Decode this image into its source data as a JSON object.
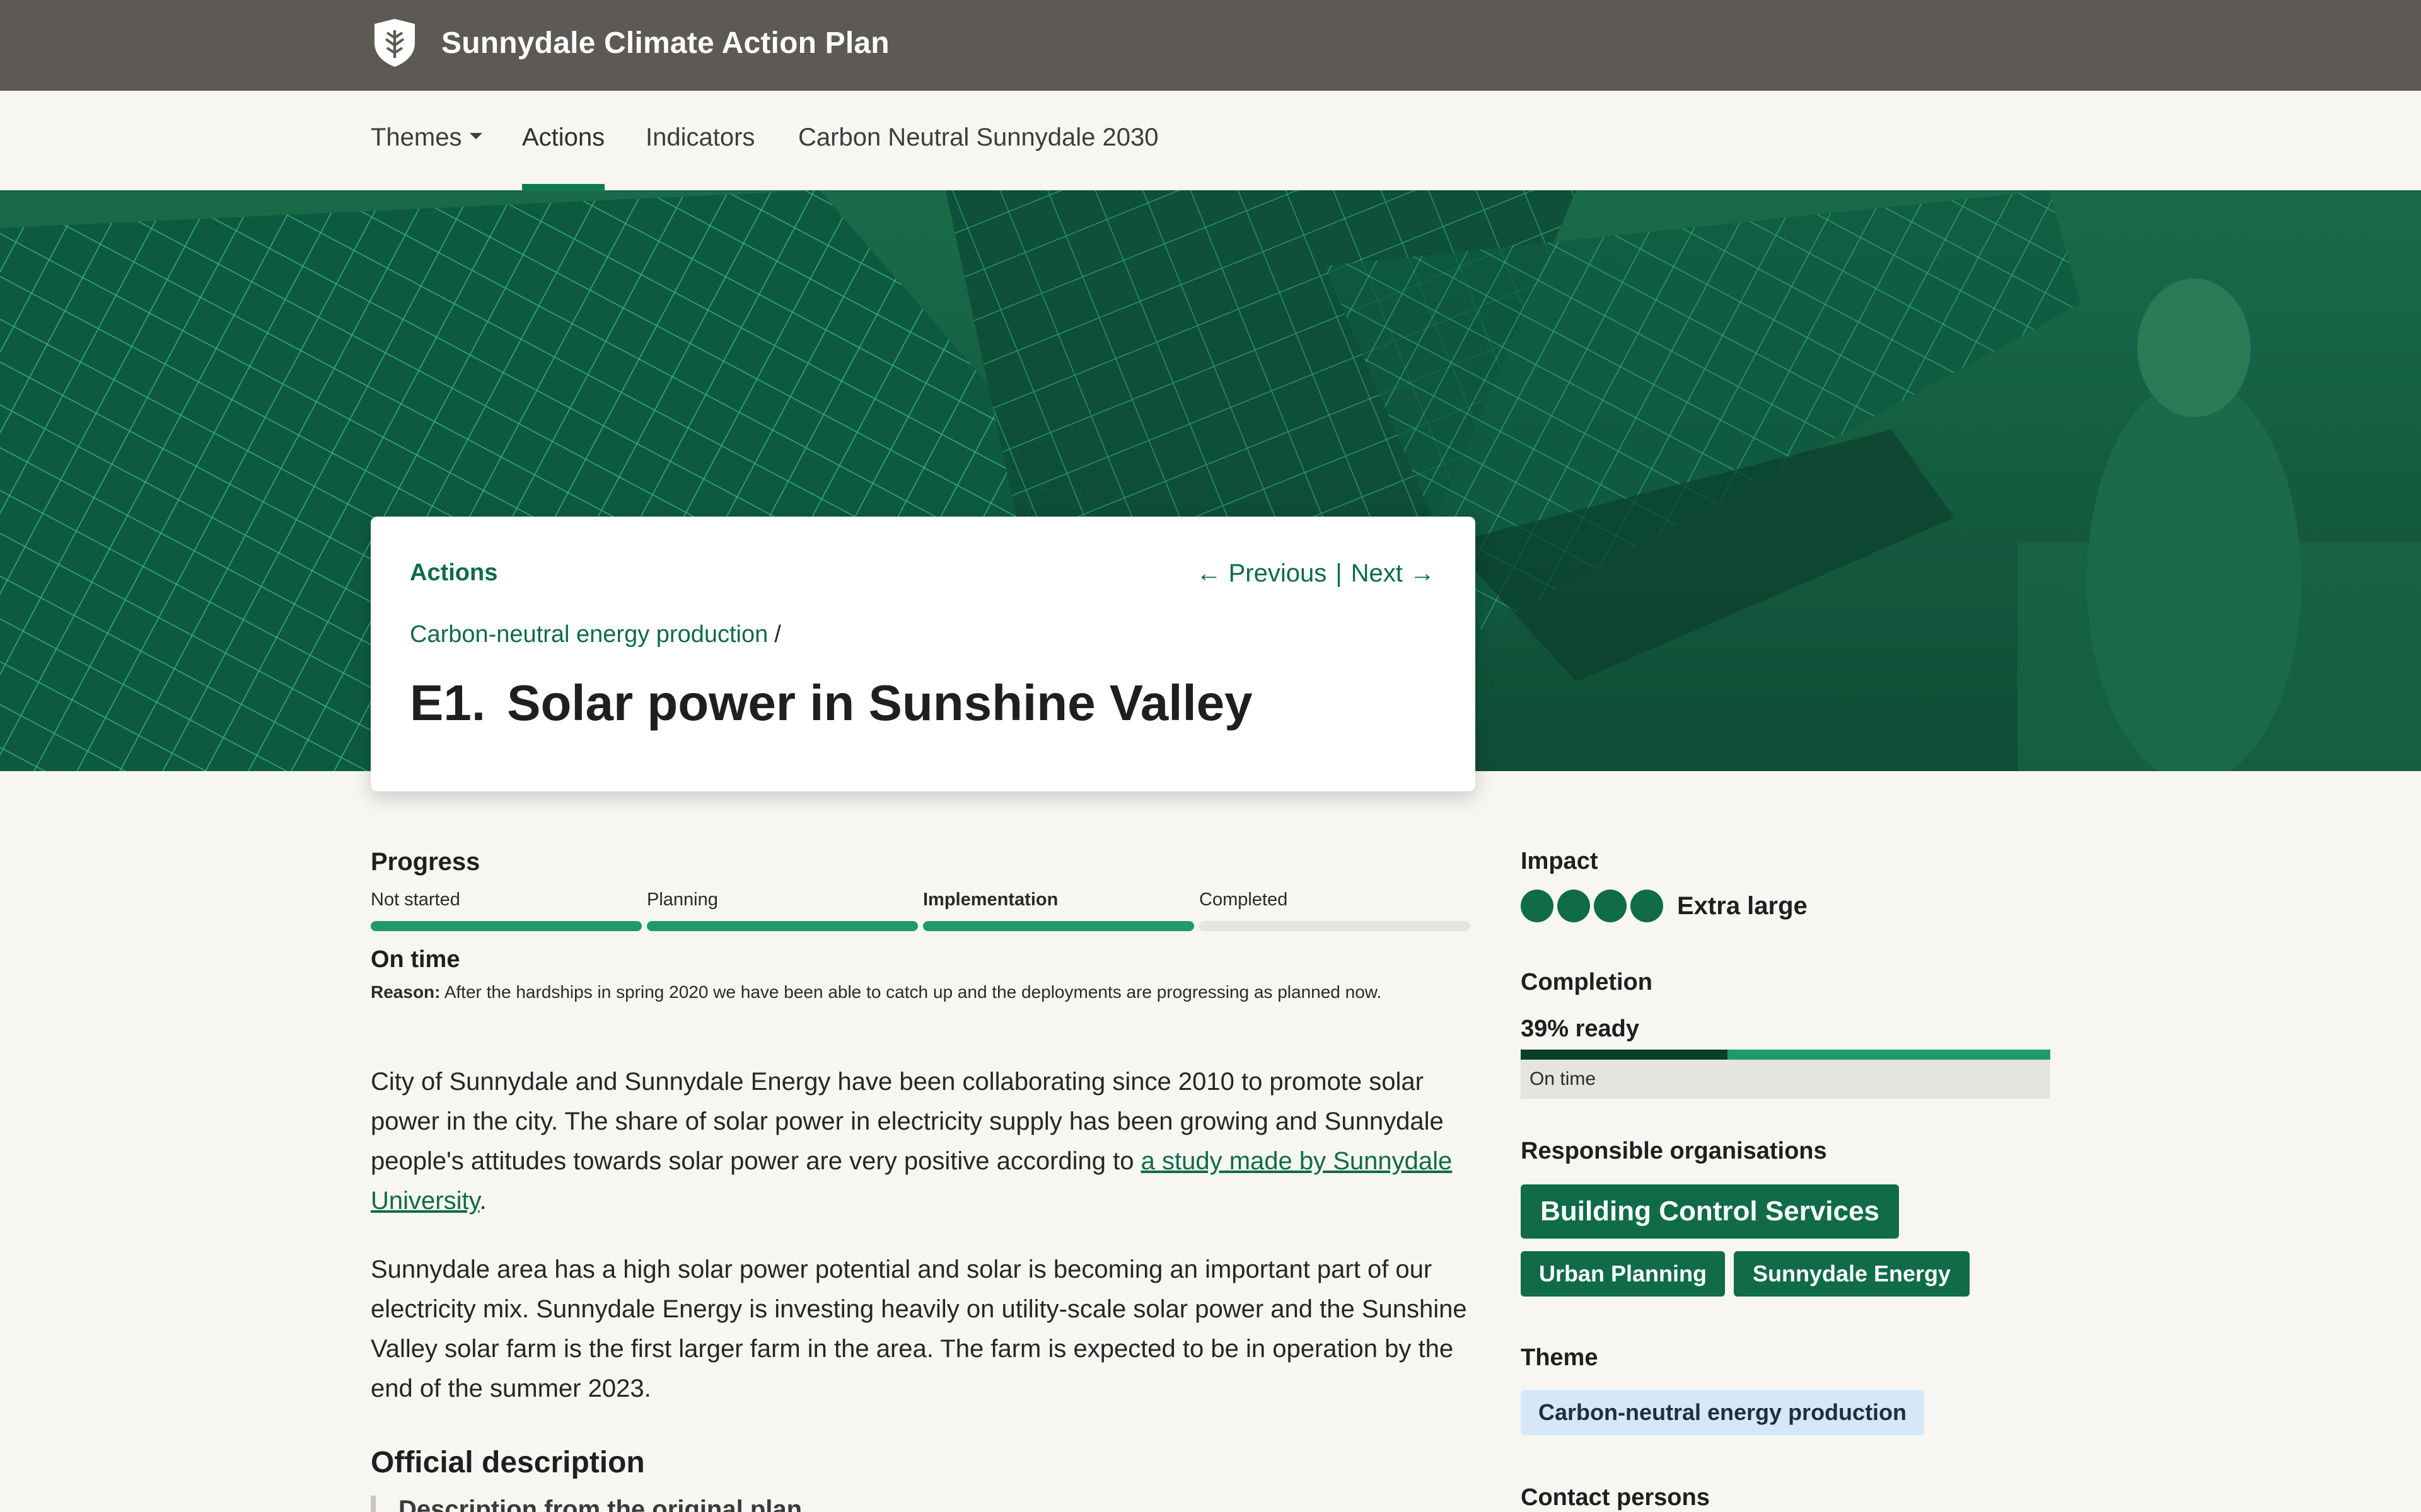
{
  "site": {
    "title": "Sunnydale Climate Action Plan",
    "logo_icon": "leaf-shield-icon"
  },
  "nav": {
    "items": [
      {
        "label": "Themes",
        "has_dropdown": true
      },
      {
        "label": "Actions",
        "active": true
      },
      {
        "label": "Indicators"
      },
      {
        "label": "Carbon Neutral Sunnydale 2030"
      }
    ]
  },
  "header": {
    "section_link": "Actions",
    "previous_label": "Previous",
    "next_label": "Next",
    "theme_link": "Carbon-neutral energy production",
    "separator": "/",
    "identifier": "E1.",
    "title": "Solar power in Sunshine Valley"
  },
  "progress": {
    "label": "Progress",
    "stages": [
      {
        "label": "Not started",
        "done": true
      },
      {
        "label": "Planning",
        "done": true
      },
      {
        "label": "Implementation",
        "done": true,
        "current": true
      },
      {
        "label": "Completed",
        "done": false
      }
    ],
    "status": "On time",
    "reason_label": "Reason:",
    "reason_text": "After the hardships in spring 2020 we have been able to catch up and the deployments are progressing as planned now."
  },
  "body": {
    "p1_before": "City of Sunnydale and Sunnydale Energy have been collaborating since 2010 to promote solar power in the city. The share of solar power in electricity supply has been growing and Sunnydale people's attitudes towards solar power are very positive according to ",
    "p1_link": "a study made by Sunnydale University",
    "p1_after": ".",
    "p2": "Sunnydale area has a high solar power potential and solar is becoming an important part of our electricity mix. Sunnydale Energy is investing heavily on utility-scale solar power and the Sunshine Valley solar farm is the first larger farm in the area. The farm is expected to be in operation by the end of the summer 2023.",
    "official_title": "Official description",
    "official_quote": "Description from the original plan"
  },
  "sidebar": {
    "impact": {
      "label": "Impact",
      "level": 4,
      "max": 4,
      "text": "Extra large"
    },
    "completion": {
      "label": "Completion",
      "text": "39% ready",
      "percent": 39,
      "status": "On time"
    },
    "orgs": {
      "label": "Responsible organisations",
      "primary": "Building Control Services",
      "others": [
        "Urban Planning",
        "Sunnydale Energy"
      ]
    },
    "theme": {
      "label": "Theme",
      "value": "Carbon-neutral energy production"
    },
    "contacts": {
      "label": "Contact persons"
    }
  },
  "colors": {
    "brand": "#0f6b48",
    "topbar": "#5d5a55",
    "progress": "#1f9a69",
    "background": "#f7f6f2"
  }
}
